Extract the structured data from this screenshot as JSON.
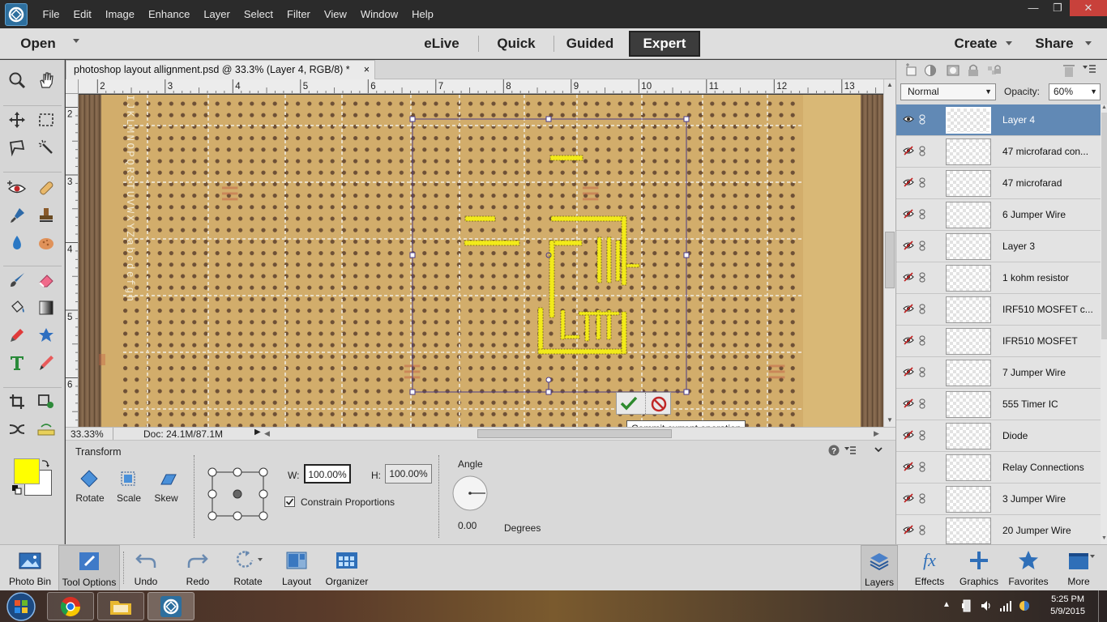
{
  "menu": [
    "File",
    "Edit",
    "Image",
    "Enhance",
    "Layer",
    "Select",
    "Filter",
    "View",
    "Window",
    "Help"
  ],
  "modebar": {
    "open": "Open",
    "modes": [
      "eLive",
      "Quick",
      "Guided",
      "Expert"
    ],
    "create": "Create",
    "share": "Share"
  },
  "document": {
    "tab_title": "photoshop layout allignment.psd @ 33.3% (Layer 4, RGB/8) *",
    "zoom": "33.33%",
    "doc_size": "Doc: 24.1M/87.1M",
    "hruler_labels": [
      "2",
      "3",
      "4",
      "5",
      "6",
      "7",
      "8",
      "9",
      "10",
      "11",
      "12",
      "13"
    ],
    "vruler_labels": [
      "2",
      "3",
      "4",
      "5",
      "6"
    ],
    "board_letters": "IJKLMNOPQRSTUVWXYZabcdefgh",
    "tooltip": "Commit current operation"
  },
  "options": {
    "section_title": "Transform",
    "modes": [
      "Rotate",
      "Scale",
      "Skew"
    ],
    "w_label": "W:",
    "w_value": "100.00%",
    "h_label": "H:",
    "h_value": "100.00%",
    "constrain_label": "Constrain Proportions",
    "constrain_checked": true,
    "angle_label": "Angle",
    "angle_value": "0.00",
    "degrees_label": "Degrees"
  },
  "layers_panel": {
    "blend_mode": "Normal",
    "opacity_label": "Opacity:",
    "opacity_value": "60%",
    "layers": [
      {
        "name": "Layer 4",
        "visible": true,
        "selected": true
      },
      {
        "name": "47 microfarad con...",
        "visible": false,
        "selected": false
      },
      {
        "name": "47 microfarad",
        "visible": false,
        "selected": false
      },
      {
        "name": "6 Jumper Wire",
        "visible": false,
        "selected": false
      },
      {
        "name": "Layer 3",
        "visible": false,
        "selected": false
      },
      {
        "name": "1 kohm resistor",
        "visible": false,
        "selected": false
      },
      {
        "name": "IRF510 MOSFET c...",
        "visible": false,
        "selected": false
      },
      {
        "name": "IFR510 MOSFET",
        "visible": false,
        "selected": false
      },
      {
        "name": "7 Jumper Wire",
        "visible": false,
        "selected": false
      },
      {
        "name": "555 Timer IC",
        "visible": false,
        "selected": false
      },
      {
        "name": "Diode",
        "visible": false,
        "selected": false
      },
      {
        "name": "Relay Connections",
        "visible": false,
        "selected": false
      },
      {
        "name": "3 Jumper Wire",
        "visible": false,
        "selected": false
      },
      {
        "name": "20 Jumper Wire",
        "visible": false,
        "selected": false
      }
    ]
  },
  "bottombar": {
    "left": [
      "Photo Bin",
      "Tool Options",
      "Undo",
      "Redo",
      "Rotate",
      "Layout",
      "Organizer"
    ],
    "right": [
      "Layers",
      "Effects",
      "Graphics",
      "Favorites",
      "More"
    ]
  },
  "taskbar": {
    "time": "5:25 PM",
    "date": "5/9/2015"
  },
  "colors": {
    "foreground": "#ffff00",
    "background": "#ffffff",
    "selected_layer": "#6189b5",
    "board": "#d2ad6b",
    "trace": "#f2ea1a"
  }
}
